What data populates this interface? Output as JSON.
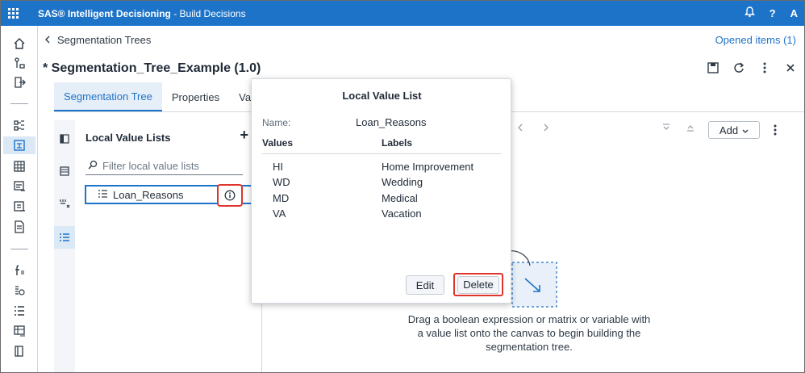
{
  "app": {
    "brand": "SAS® Intelligent Decisioning",
    "separator": " - ",
    "section": "Build Decisions",
    "help": "?",
    "user_initial": "A"
  },
  "breadcrumb": {
    "label": "Segmentation Trees"
  },
  "opened_items": "Opened items (1)",
  "page_title": "* Segmentation_Tree_Example (1.0)",
  "tabs": [
    {
      "label": "Segmentation Tree",
      "active": true
    },
    {
      "label": "Properties",
      "active": false
    },
    {
      "label": "Var",
      "active": false
    }
  ],
  "local_value_lists": {
    "title": "Local Value Lists",
    "add_label": "+",
    "filter_placeholder": "Filter local value lists",
    "items": [
      {
        "label": "Loan_Reasons"
      }
    ]
  },
  "canvas": {
    "add_label": "Add",
    "hint": "Drag a boolean expression or matrix or variable with a value list onto the canvas to begin building the segmentation tree."
  },
  "popup": {
    "title": "Local Value List",
    "name_label": "Name:",
    "name_value": "Loan_Reasons",
    "values_header": "Values",
    "labels_header": "Labels",
    "rows": [
      {
        "value": "HI",
        "label": "Home Improvement"
      },
      {
        "value": "WD",
        "label": "Wedding"
      },
      {
        "value": "MD",
        "label": "Medical"
      },
      {
        "value": "VA",
        "label": "Vacation"
      }
    ],
    "edit_label": "Edit",
    "delete_label": "Delete"
  },
  "colors": {
    "brand_blue": "#1d73c8",
    "highlight_red": "#e0332c"
  }
}
